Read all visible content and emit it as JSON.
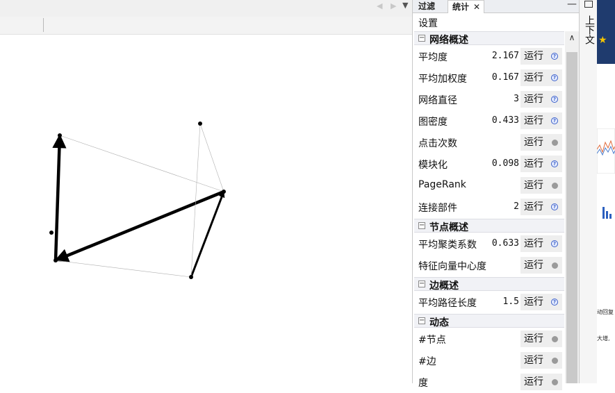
{
  "graph": {
    "nodes": [
      {
        "id": "n1"
      },
      {
        "id": "n2"
      },
      {
        "id": "n3"
      },
      {
        "id": "n4"
      },
      {
        "id": "n5"
      },
      {
        "id": "n6"
      }
    ],
    "edges": [
      {
        "from": "n4",
        "to": "n1",
        "weight": "heavy",
        "arrow": true
      },
      {
        "from": "n5",
        "to": "n4",
        "weight": "heavy",
        "arrow": true
      },
      {
        "from": "n6",
        "to": "n5",
        "weight": "medium",
        "arrow": true
      },
      {
        "from": "n2",
        "to": "n5",
        "weight": "thin",
        "arrow": false
      },
      {
        "from": "n2",
        "to": "n6",
        "weight": "thin",
        "arrow": false
      },
      {
        "from": "n1",
        "to": "n5",
        "weight": "thin",
        "arrow": false
      },
      {
        "from": "n4",
        "to": "n6",
        "weight": "thin",
        "arrow": false
      }
    ]
  },
  "panel": {
    "tabs": [
      {
        "label": "过滤"
      },
      {
        "label": "统计"
      }
    ],
    "close_glyph": "✕",
    "minimize_glyph": "—",
    "settings_label": "设置",
    "sections": [
      {
        "title": "网络概述",
        "rows": [
          {
            "label": "平均度",
            "value": "2.167",
            "run": "运行",
            "icon": "help-icon"
          },
          {
            "label": "平均加权度",
            "value": "0.167",
            "run": "运行",
            "icon": "help-icon"
          },
          {
            "label": "网络直径",
            "value": "3",
            "run": "运行",
            "icon": "help-icon"
          },
          {
            "label": "图密度",
            "value": "0.433",
            "run": "运行",
            "icon": "help-icon"
          },
          {
            "label": "点击次数",
            "value": "",
            "run": "运行",
            "icon": "dot-icon"
          },
          {
            "label": "模块化",
            "value": "0.098",
            "run": "运行",
            "icon": "help-icon"
          },
          {
            "label": "PageRank",
            "value": "",
            "run": "运行",
            "icon": "dot-icon"
          },
          {
            "label": "连接部件",
            "value": "2",
            "run": "运行",
            "icon": "help-icon"
          }
        ]
      },
      {
        "title": "节点概述",
        "rows": [
          {
            "label": "平均聚类系数",
            "value": "0.633",
            "run": "运行",
            "icon": "help-icon"
          },
          {
            "label": "特征向量中心度",
            "value": "",
            "run": "运行",
            "icon": "dot-icon"
          }
        ]
      },
      {
        "title": "边概述",
        "rows": [
          {
            "label": "平均路径长度",
            "value": "1.5",
            "run": "运行",
            "icon": "help-icon"
          }
        ]
      },
      {
        "title": "动态",
        "rows": [
          {
            "label": "#节点",
            "value": "",
            "run": "运行",
            "icon": "dot-icon"
          },
          {
            "label": "#边",
            "value": "",
            "run": "运行",
            "icon": "dot-icon"
          },
          {
            "label": "度",
            "value": "",
            "run": "运行",
            "icon": "dot-icon"
          }
        ]
      }
    ]
  },
  "context_strip": {
    "label": "上下文"
  },
  "nav": {
    "left": "◀",
    "right": "▶",
    "down": "▼",
    "scroll_up": "∧"
  },
  "background_window": {
    "fragments": [
      "动回复",
      "大增,"
    ]
  },
  "colors": {
    "panel_bg": "#ffffff",
    "section_bg": "#f1f2f6",
    "button_bg": "#eeeeee",
    "help_icon": "#3a5ec8",
    "edge": "#000000"
  }
}
